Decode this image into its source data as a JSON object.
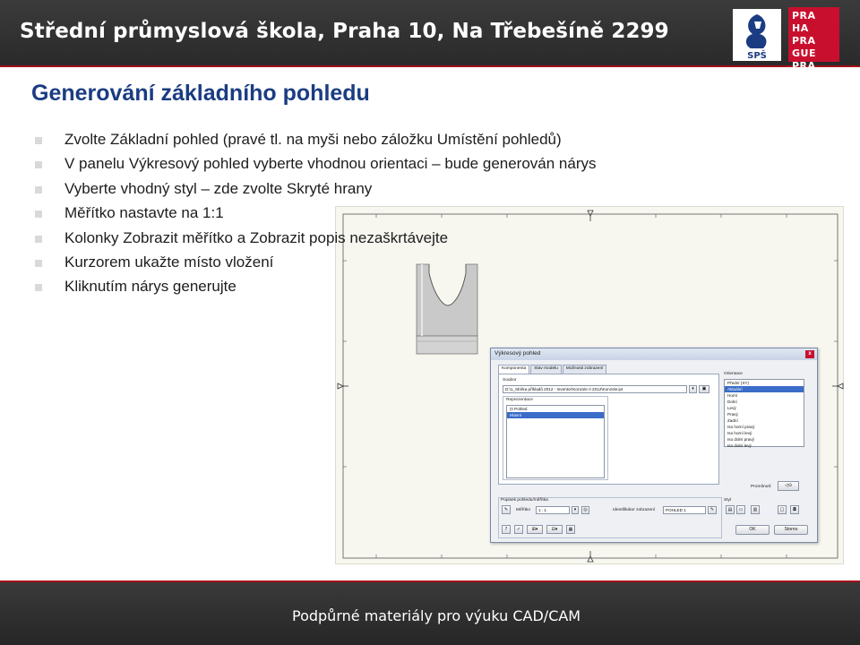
{
  "header": {
    "title": "Střední průmyslová škola, Praha 10, Na Třebešíně 2299",
    "logo_sps": "SPŠ",
    "logo_praha_lines": [
      "PRA HA",
      "PRA GUE",
      "PRA GA",
      "PRA G"
    ]
  },
  "heading": "Generování základního pohledu",
  "bullets": [
    "Zvolte Základní pohled (pravé tl. na myši nebo záložku Umístění pohledů)",
    "V panelu Výkresový pohled vyberte vhodnou orientaci – bude generován nárys",
    "Vyberte vhodný styl – zde zvolte Skryté hrany",
    "Měřítko nastavte na 1:1",
    "Kolonky Zobrazit měřítko a Zobrazit popis nezaškrtávejte",
    "Kurzorem ukažte místo vložení",
    "Kliknutím nárys generujte"
  ],
  "dialog": {
    "title": "Výkresový pohled",
    "close_label": "x",
    "tabs": [
      "Komponenta",
      "Stav modelu",
      "Možnosti zobrazení"
    ],
    "file_label": "Soubor",
    "file_value": "D:\\1_Sbírka příkladů 2012 - Inventor\\Konzole II 2012\\Konzole.ipt",
    "representation_label": "Reprezentace",
    "representation_items": [
      "Pohled",
      "Hlavní"
    ],
    "orientation_label": "Orientace",
    "orientation_items": [
      "Přední (XY)",
      "Aktuální",
      "Horní",
      "Dolní",
      "Levý",
      "Pravý",
      "Zadní",
      "Iso horní pravý",
      "Iso horní levý",
      "Iso dolní pravý",
      "Iso dolní levý"
    ],
    "orientation_selected_index": 1,
    "projection_label": "Promítnutí:",
    "label_group": "Popisek pohledu/měřítka",
    "scale_label": "Měřítko",
    "scale_value": "1 : 1",
    "identifier_label": "Identifikátor zobrazení",
    "identifier_value": "POHLED 1",
    "style_label": "Styl",
    "ok_label": "OK",
    "cancel_label": "Storno"
  },
  "footer": "Podpůrné materiály pro výuku CAD/CAM",
  "colors": {
    "brand_red": "#c8102e",
    "heading_blue": "#1b3c82",
    "header_dark": "#2e2e2e"
  }
}
